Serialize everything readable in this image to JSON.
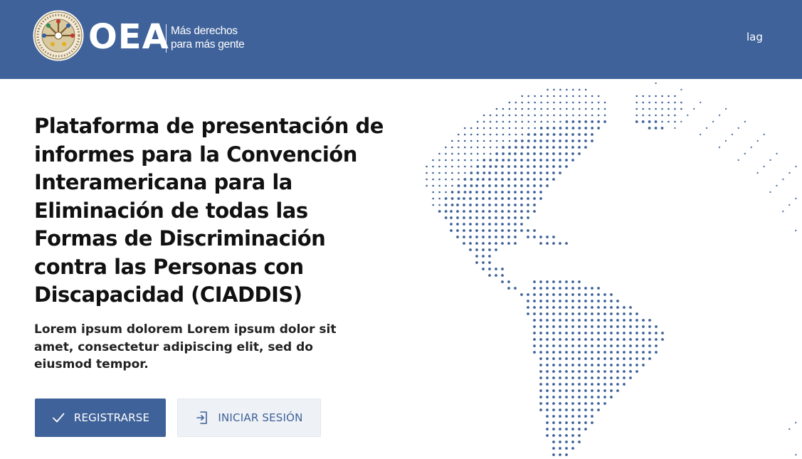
{
  "header": {
    "brand": "OEA",
    "tagline_line1": "Más derechos",
    "tagline_line2": "para más gente",
    "seal_icon": "oas-seal-icon",
    "lang_link": "lag"
  },
  "hero": {
    "title": "Plataforma de presentación de informes para la Convención Interamericana para la Eliminación de todas las Formas de Discriminación contra las Personas con Discapacidad (CIADDIS)",
    "subtitle": "Lorem ipsum dolorem Lorem ipsum dolor sit amet, consectetur adipiscing elit, sed do eiusmod tempor."
  },
  "actions": {
    "register_label": "REGISTRARSE",
    "register_icon": "checkmark-icon",
    "login_label": "INICIAR SESIÓN",
    "login_icon": "login-icon"
  },
  "illustration": {
    "icon": "dotted-globe-americas",
    "color": "#3f629a"
  },
  "colors": {
    "primary": "#3f629a",
    "secondary_button_bg": "#eef1f5",
    "text": "#111111"
  }
}
